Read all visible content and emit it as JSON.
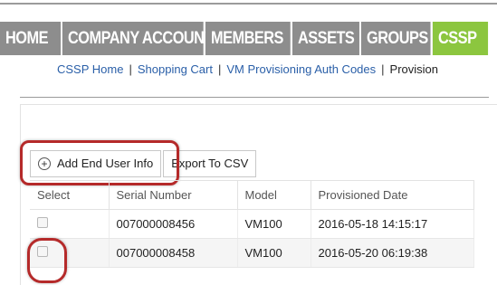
{
  "nav": {
    "items": [
      {
        "label": "HOME",
        "active": false
      },
      {
        "label": "COMPANY ACCOUNT",
        "active": false
      },
      {
        "label": "MEMBERS",
        "active": false
      },
      {
        "label": "ASSETS",
        "active": false
      },
      {
        "label": "GROUPS",
        "active": false
      },
      {
        "label": "CSSP",
        "active": true
      }
    ],
    "colors": {
      "inactive": "#8d8d8d",
      "active": "#8cc63f"
    }
  },
  "subnav": {
    "links": [
      "CSSP Home",
      "Shopping Cart",
      "VM Provisioning Auth Codes"
    ],
    "separator": "|",
    "current": "Provision"
  },
  "toolbar": {
    "add_label": "Add End User Info",
    "add_icon": "plus-circle-icon",
    "export_label": "Export To CSV"
  },
  "table": {
    "headers": [
      "Select",
      "Serial Number",
      "Model",
      "Provisioned Date"
    ],
    "rows": [
      {
        "serial": "007000008456",
        "model": "VM100",
        "date": "2016-05-18 14:15:17",
        "checked": false
      },
      {
        "serial": "007000008458",
        "model": "VM100",
        "date": "2016-05-20 06:19:38",
        "checked": false
      }
    ]
  },
  "annotations": {
    "highlight_color": "#b52a2a"
  }
}
